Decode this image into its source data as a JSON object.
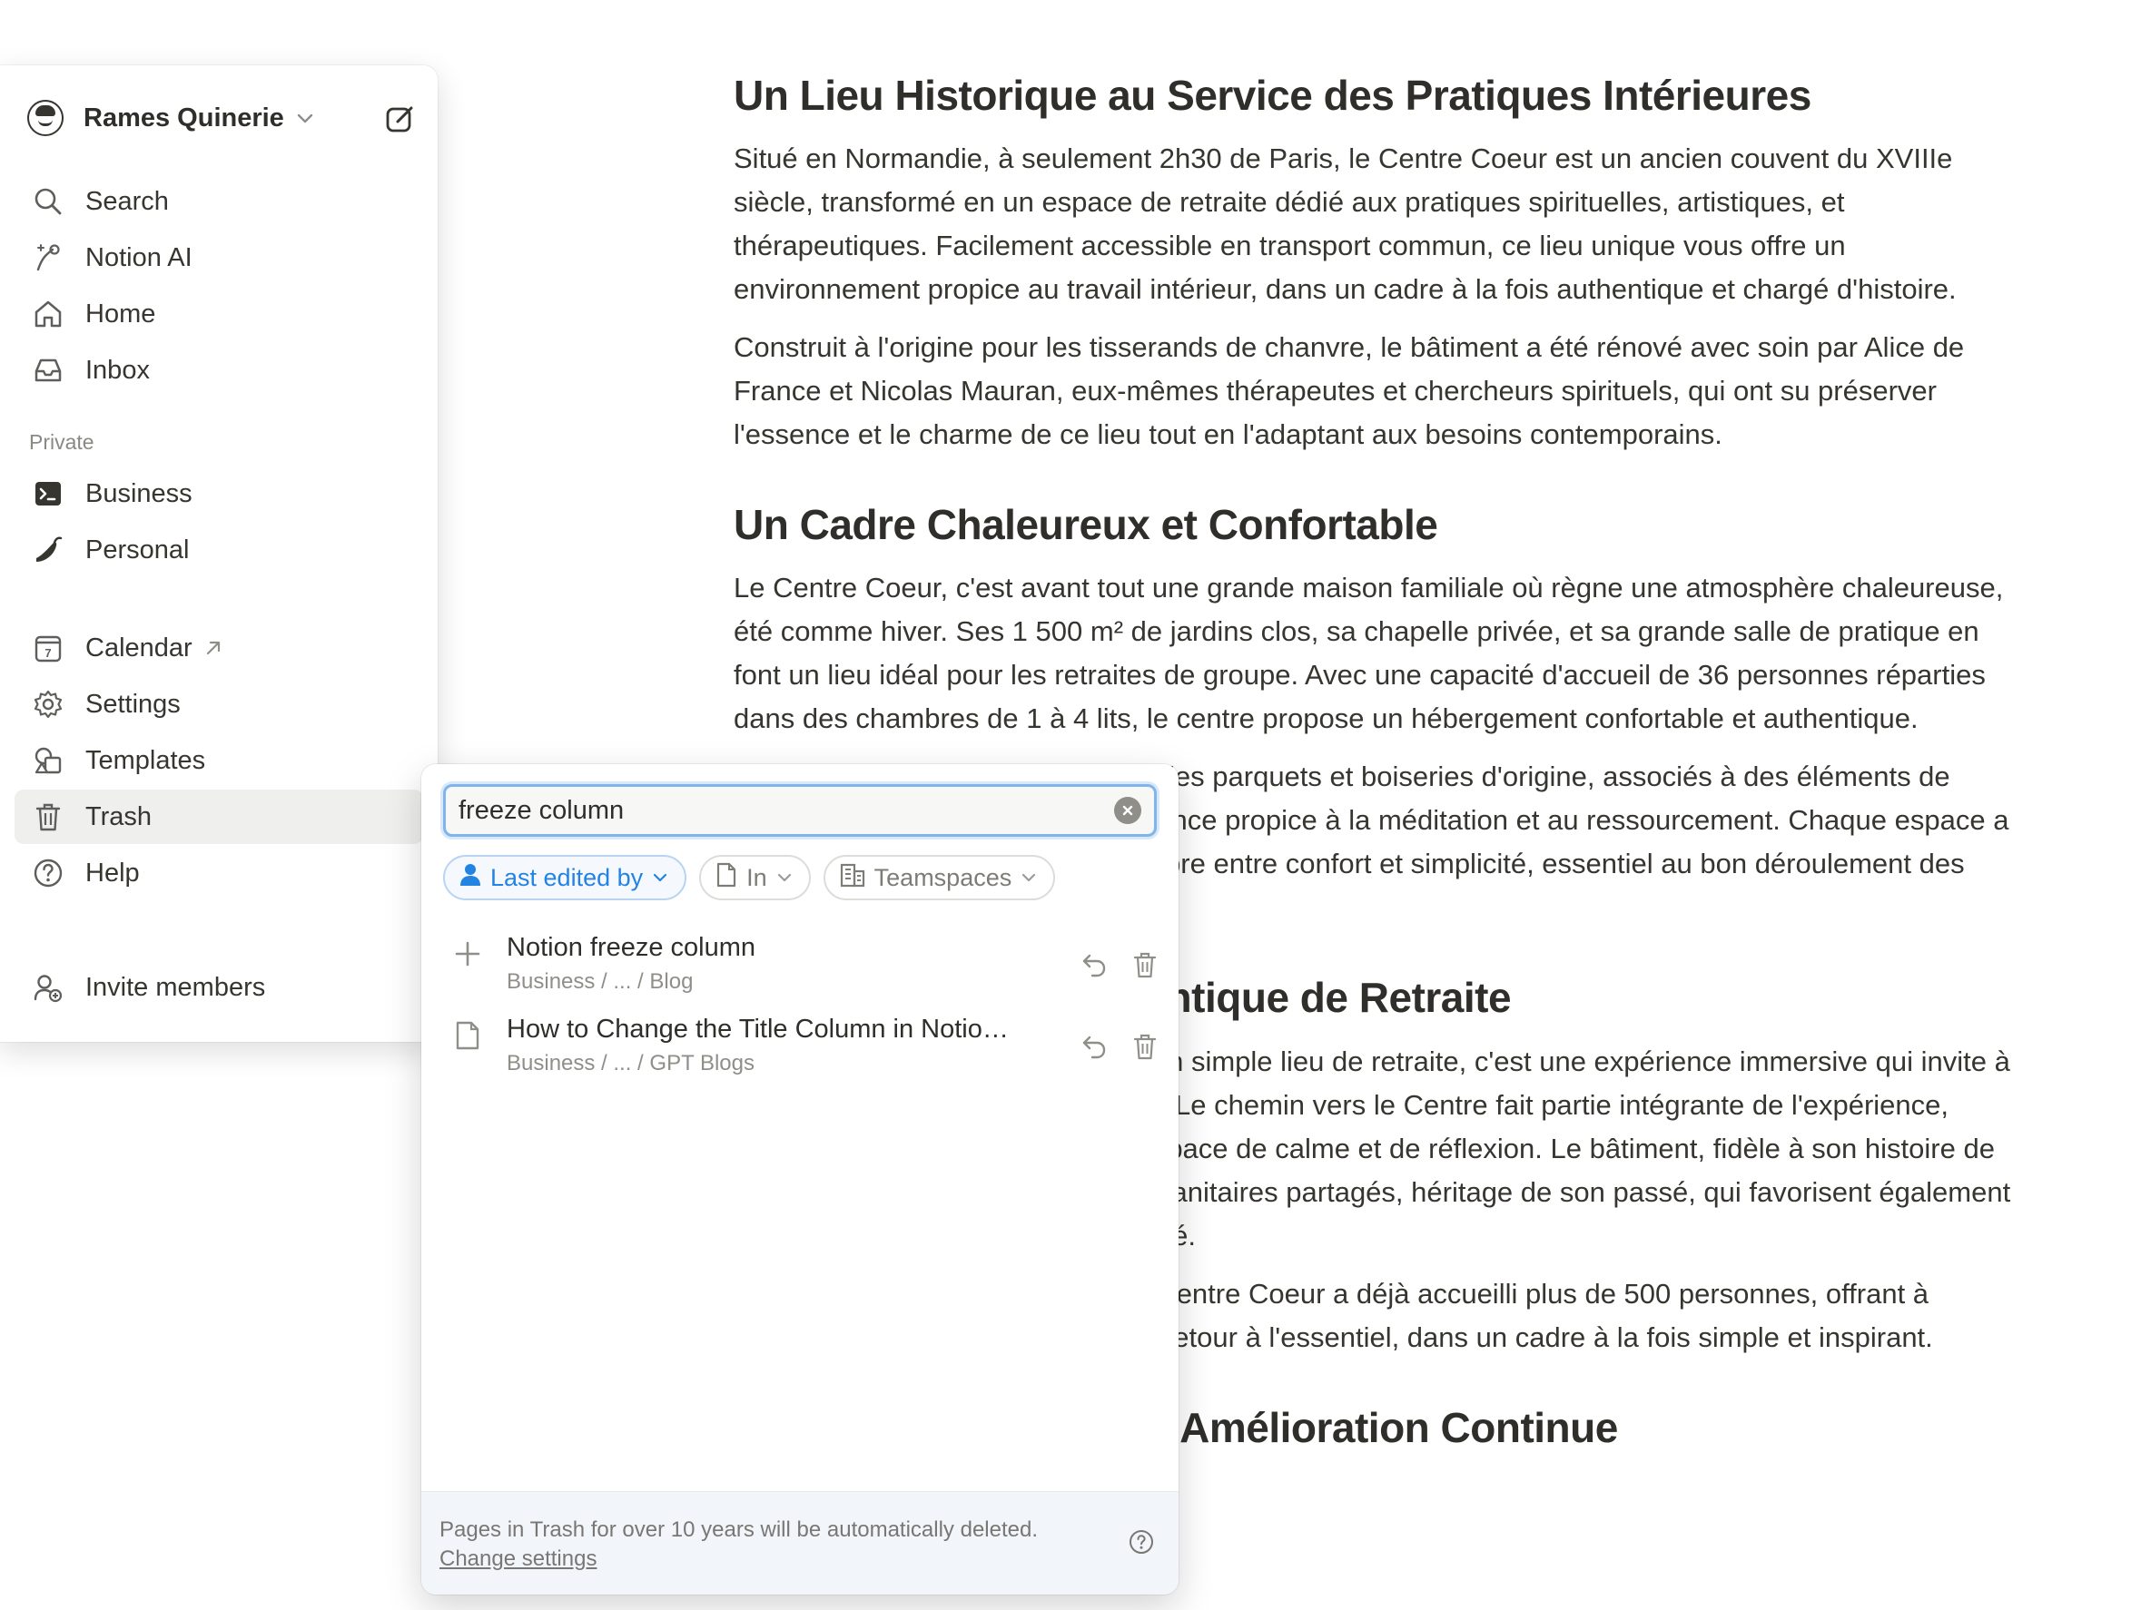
{
  "sidebar": {
    "workspace": {
      "name": "Rames Quinerie"
    },
    "nav": [
      {
        "label": "Search",
        "icon": "search-icon"
      },
      {
        "label": "Notion AI",
        "icon": "notion-ai-icon"
      },
      {
        "label": "Home",
        "icon": "home-icon"
      },
      {
        "label": "Inbox",
        "icon": "inbox-icon"
      }
    ],
    "private_label": "Private",
    "private_pages": [
      {
        "label": "Business",
        "icon": "terminal-icon"
      },
      {
        "label": "Personal",
        "icon": "pepper-icon"
      }
    ],
    "tools": [
      {
        "label": "Calendar",
        "icon": "calendar-icon",
        "calendar_day": "7"
      },
      {
        "label": "Settings",
        "icon": "gear-icon"
      },
      {
        "label": "Templates",
        "icon": "templates-icon"
      },
      {
        "label": "Trash",
        "icon": "trash-icon"
      },
      {
        "label": "Help",
        "icon": "help-icon"
      }
    ],
    "invite": {
      "label": "Invite members",
      "icon": "invite-icon"
    }
  },
  "trash_popover": {
    "search": {
      "value": "freeze column",
      "placeholder": ""
    },
    "filters": [
      {
        "label": "Last edited by",
        "icon": "person-icon",
        "active": true
      },
      {
        "label": "In",
        "icon": "page-icon",
        "active": false
      },
      {
        "label": "Teamspaces",
        "icon": "building-icon",
        "active": false
      }
    ],
    "results": [
      {
        "title": "Notion freeze column",
        "path": "Business / ... / Blog",
        "icon": "plus-icon"
      },
      {
        "title": "How to Change the Title Column in Notion (...",
        "path": "Business / ... / GPT Blogs",
        "icon": "page-icon"
      }
    ],
    "footer": {
      "text": "Pages in Trash for over 10 years will be automatically deleted.",
      "link": "Change settings"
    }
  },
  "document": {
    "sections": [
      {
        "heading": "Un Lieu Historique au Service des Pratiques Intérieures",
        "paragraphs": [
          "Situé en Normandie, à seulement 2h30 de Paris, le Centre Coeur est un ancien couvent du XVIIIe siècle, transformé en un espace de retraite dédié aux pratiques spirituelles, artistiques, et thérapeutiques. Facilement accessible en transport commun, ce lieu unique vous offre un environnement propice au travail intérieur, dans un cadre à la fois authentique et chargé d'histoire.",
          "Construit à l'origine pour les tisserands de chanvre, le bâtiment a été rénové avec soin par Alice de France et Nicolas Mauran, eux-mêmes thérapeutes et chercheurs spirituels, qui ont su préserver l'essence et le charme de ce lieu tout en l'adaptant aux besoins contemporains."
        ]
      },
      {
        "heading": "Un Cadre Chaleureux et Confortable",
        "paragraphs": [
          "Le Centre Coeur, c'est avant tout une grande maison familiale où règne une atmosphère chaleureuse, été comme hiver. Ses 1 500 m² de jardins clos, sa chapelle privée, et sa grande salle de pratique en font un lieu idéal pour les retraites de groupe. Avec une capacité d'accueil de 36 personnes réparties dans des chambres de 1 à 4 lits, le centre propose un hébergement confortable et authentique.",
          "Les espaces intérieurs conservent les parquets et boiseries d'origine, associés à des éléments de confort moderne, créant une ambiance propice à la méditation et au ressourcement. Chaque espace a été pensé pour offrir un juste équilibre entre confort et simplicité, essentiel au bon déroulement des retraites."
        ]
      },
      {
        "heading": "Une Expérience Authentique de Retraite",
        "paragraphs": [
          "Le Centre Coeur est bien plus qu'un simple lieu de retraite, c'est une expérience immersive qui invite à se déconnecter de notre quotidien. Le chemin vers le Centre fait partie intégrante de l'expérience, marquant une transition vers un espace de calme et de réflexion. Le bâtiment, fidèle à son histoire de vie en communauté, propose des sanitaires partagés, héritage de son passé, qui favorisent également ainsi l'esprit collectif et la convivialité.",
          "Depuis son ouverture en 2022, le Centre Coeur a déjà accueilli plus de 500 personnes, offrant à chacun une expérience unique de retour à l'essentiel, dans un cadre à la fois simple et inspirant."
        ]
      },
      {
        "heading": "Un Engagement pour l'Amélioration Continue",
        "paragraphs": []
      }
    ]
  },
  "colors": {
    "accent": "#2383e2",
    "text": "#37352f",
    "muted": "#8f8e89",
    "footer_bg": "#f2f5fa"
  }
}
